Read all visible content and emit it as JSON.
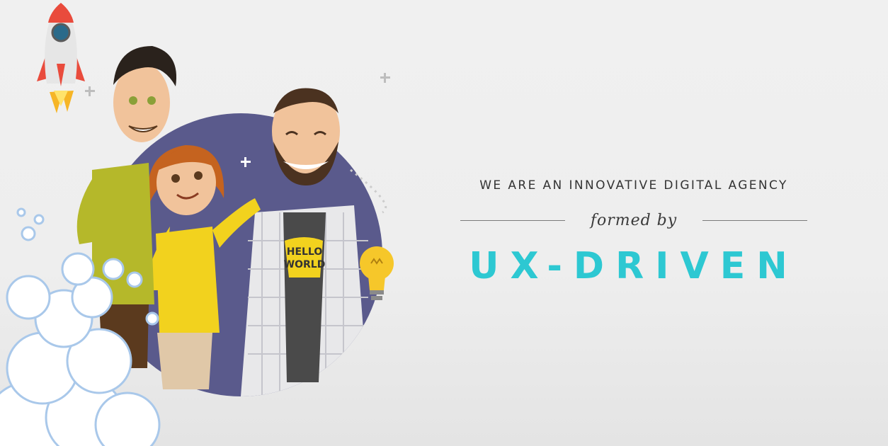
{
  "hero": {
    "tagline": "WE ARE AN INNOVATIVE DIGITAL AGENCY",
    "formed_by": "formed by",
    "brand": "UX-DRIVEN"
  },
  "shirt_text": {
    "line1": "HELLO",
    "line2": "WORLD"
  },
  "icons": [
    "rocket-icon",
    "lightbulb-icon",
    "plus-sparkle-icon",
    "smoke-cloud-icon"
  ],
  "colors": {
    "brand": "#2dc8d2",
    "circle": "#5a5a8c",
    "yellow": "#f2d21e",
    "green_sweater": "#b5b82a",
    "text": "#333333"
  }
}
